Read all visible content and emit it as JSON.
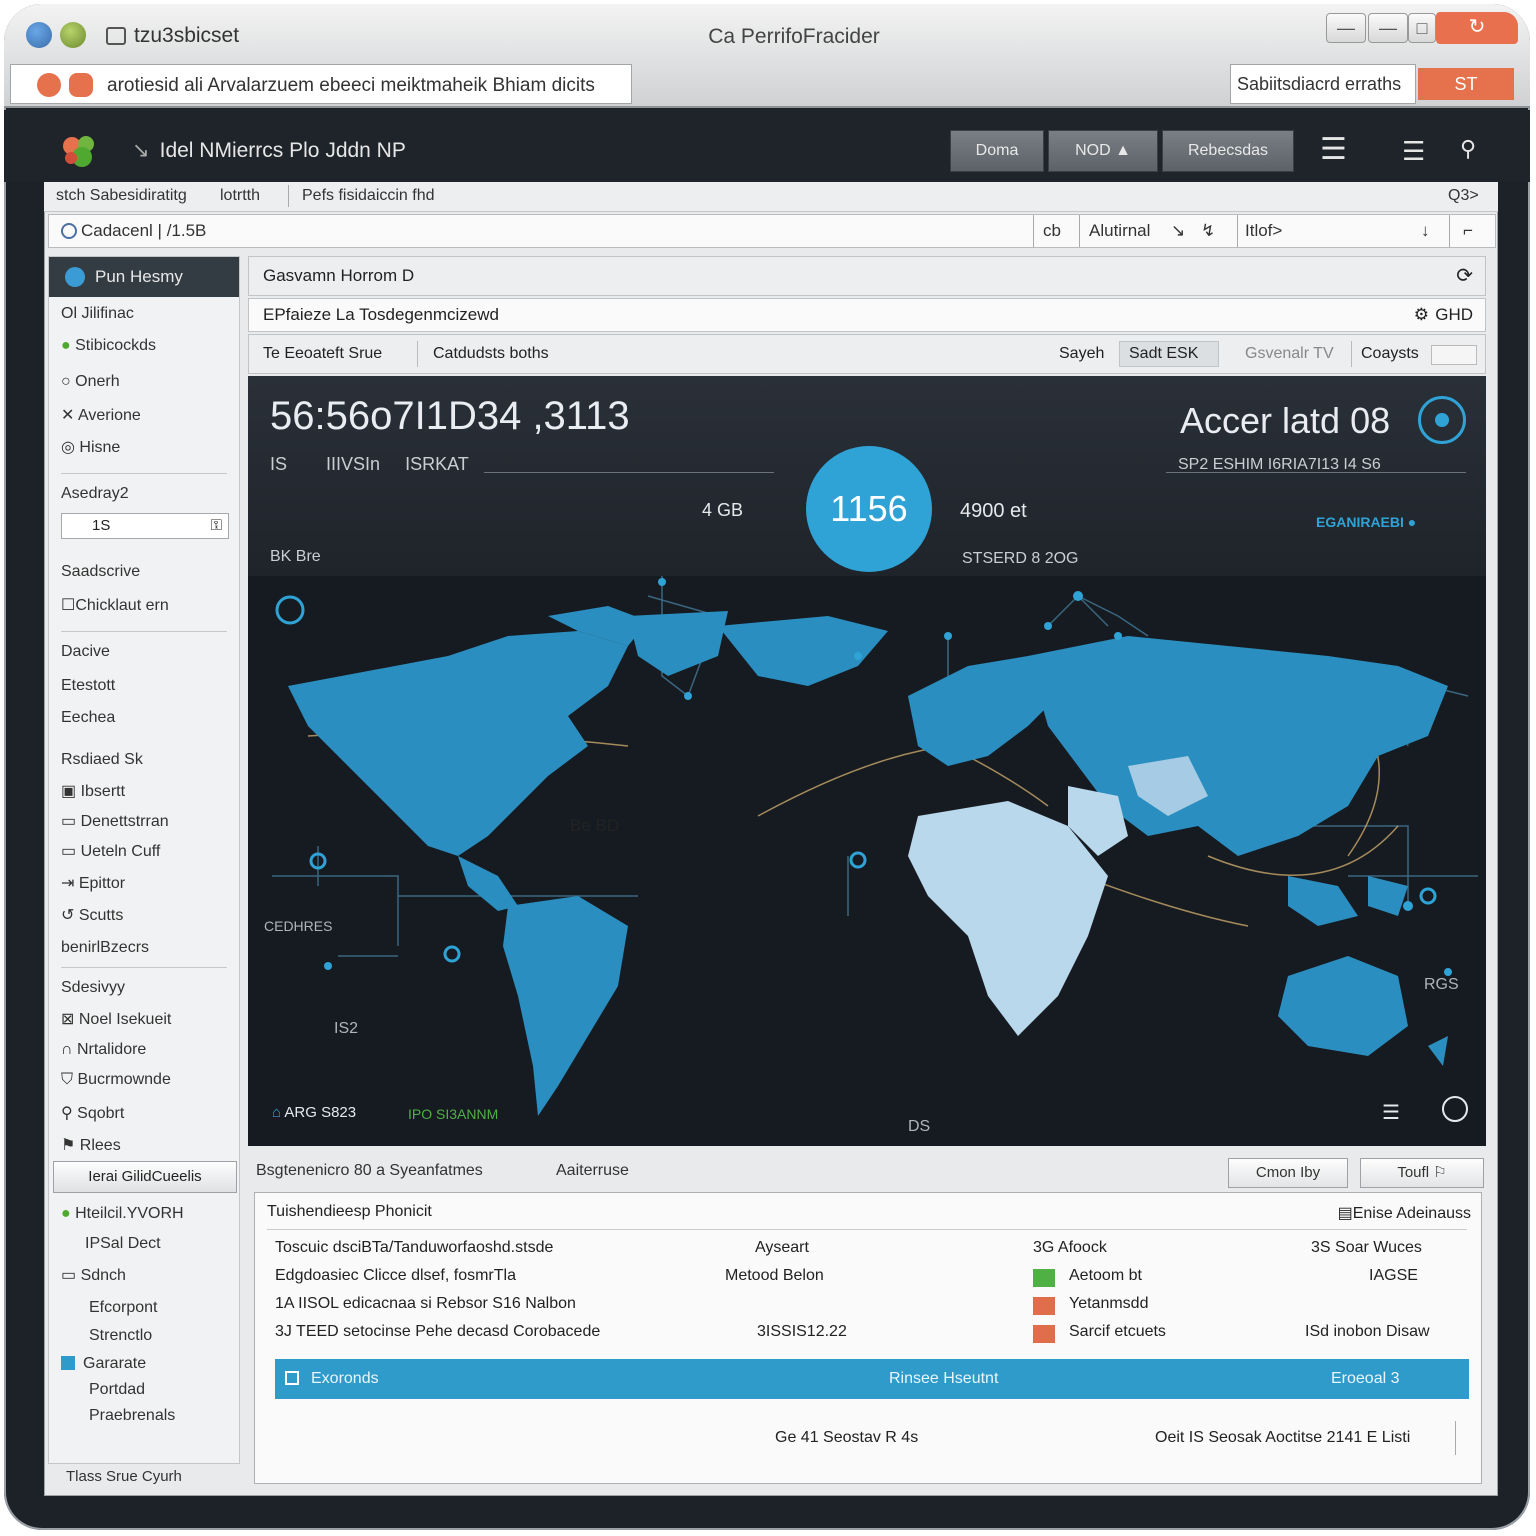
{
  "window": {
    "doc_title": "tzu3sbicset",
    "app_title": "Ca PerrifoFracider",
    "address": "arotiesid ali Arvalarzuem ebeeci meiktmaheik Bhiam dicits",
    "search": "Sabiitsdiacrd erraths",
    "search_button": "ST",
    "btn_min": "—",
    "btn_max": "□",
    "btn_close": "↻"
  },
  "header": {
    "app_name": "Idel NMierrcs Plo Jddn NP",
    "buttons": [
      "Doma",
      "NOD",
      "Rebecsdas"
    ],
    "nod_arrow": "▲",
    "menu_icon": "☰",
    "search_icon": "⚲"
  },
  "toolbar": {
    "crumb1": "stch Sabesidiratitg",
    "crumb1b": "lotrtth",
    "crumb2": "Pefs fisidaiccin fhd",
    "right_code": "Q3>",
    "filter_label": "Cadacenl",
    "filter_value": "/1.5B",
    "icon_a": "cb",
    "option": "Alutirnal",
    "icon_b": "↘",
    "icon_c": "↯",
    "field": "Itlof>",
    "icon_d": "↓",
    "icon_e": "⌐"
  },
  "sidebar": {
    "title": "Pun Hesmy",
    "group1": [
      "Ol Jilifinac",
      "Stibicockds",
      "Onerh",
      "Averione",
      "Hisne"
    ],
    "search_label": "Asedray2",
    "search_value": "1S",
    "search_lock": "⚿",
    "group2_head": "Saadscrive",
    "group2": [
      "Chicklaut ern"
    ],
    "group3_head": "Dacive",
    "group3": [
      "Etestott",
      "Eechea"
    ],
    "group4_head": "Rsdiaed Sk",
    "group4": [
      "Ibsertt",
      "Denettstrran",
      "Ueteln Cuff",
      "Epittor",
      "Scutts"
    ],
    "group5_head": "benirlBzecrs",
    "group6_head": "Sdesivyy",
    "group6": [
      "Noel Isekueit",
      "Nrtalidore",
      "Bucrmownde",
      "Sqobrt",
      "Rlees"
    ],
    "footer_button": "Ierai GilidCueelis",
    "bottom_items": [
      "Hteilcil.YVORH",
      "IPSal Dect",
      "Sdnch",
      "Efcorpont",
      "Strenctlo",
      "Gararate",
      "Portdad",
      "Praebrenals"
    ],
    "bottom_footer": "Tlass Srue Cyurh"
  },
  "main": {
    "header": "Gasvamn Horrom D",
    "header_icon": "⟳",
    "subheader": "EPfaieze La Tosdegenmcizewd",
    "sub_right_code": "GHD",
    "tabs_left": [
      "Te Eeoateft Srue",
      "Catdudsts boths"
    ],
    "tabs_right": [
      "Sayeh",
      "Sadt ESK",
      "Gsvenalr TV",
      "Coaysts"
    ]
  },
  "dashboard": {
    "big_number": "56:56o7I1D34 ,3113",
    "sub_row": [
      "IS",
      "IIIVSIn",
      "ISRKAT"
    ],
    "left_stat": "4 GB",
    "circle_value": "1156",
    "mid_stat": "4900 et",
    "right_title": "Accer latd 08",
    "right_sub": "SP2 ESHIM   I6RIA7I13 I4 S6",
    "right_link": "EGANIRAEBI",
    "left_label": "BK Bre",
    "mid_label": "STSERD 8 2OG",
    "map_labels": {
      "label_bd": "Be BD",
      "label_cn": "CEDHRES",
      "label_is2": "IS2",
      "label_rgs": "RGS",
      "label_ds": "DS",
      "label_home": "ARG S823",
      "label_green": "IPO SI3ANNM"
    },
    "accent": "#2f9bcb",
    "map_land": "#2a8fc0",
    "map_africa": "#b9d8ec"
  },
  "bottom": {
    "title": "Bsgtenenicro 80 a Syeanfatmes",
    "title2": "Aaiterruse",
    "btn1": "Cmon Iby",
    "btn2": "Toufl",
    "panel_title": "Tuishendieesp Phonicit",
    "panel_right": "Enise Adeinauss",
    "rows": [
      {
        "c1": "Toscuic dsciBTa/Tanduworfaoshd.stsde",
        "c2": "Ayseart",
        "c3": "3G   Afoock",
        "c4": "3S   Soar Wuces"
      },
      {
        "c1": "Edgdoasiec Clicce dlsef, fosmrTla",
        "c2": "Metood Belon",
        "c3": "Aetoom bt",
        "c4": "IAGSE"
      },
      {
        "c1": "1A IISOL edicacnaa si Rebsor S16 Nalbon",
        "c2": "",
        "c3": "Yetanmsdd",
        "c4": ""
      },
      {
        "c1": "3J TEED setocinse Pehe decasd Corobacede",
        "c2": "3ISSIS12.22",
        "c3": "Sarcif etcuets",
        "c4": "ISd inobon Disaw"
      }
    ],
    "swatch_colors": [
      "#4fb043",
      "#e06e4a",
      "#e06e4a"
    ],
    "selected_left": "Exoronds",
    "selected_mid": "Rinsee Hseutnt",
    "selected_right": "Eroeoal 3",
    "footer_left": "Ge 41 Seostav R 4s",
    "footer_right": "Oeit IS Seosak  Aoctitse 2141 E Listi"
  }
}
